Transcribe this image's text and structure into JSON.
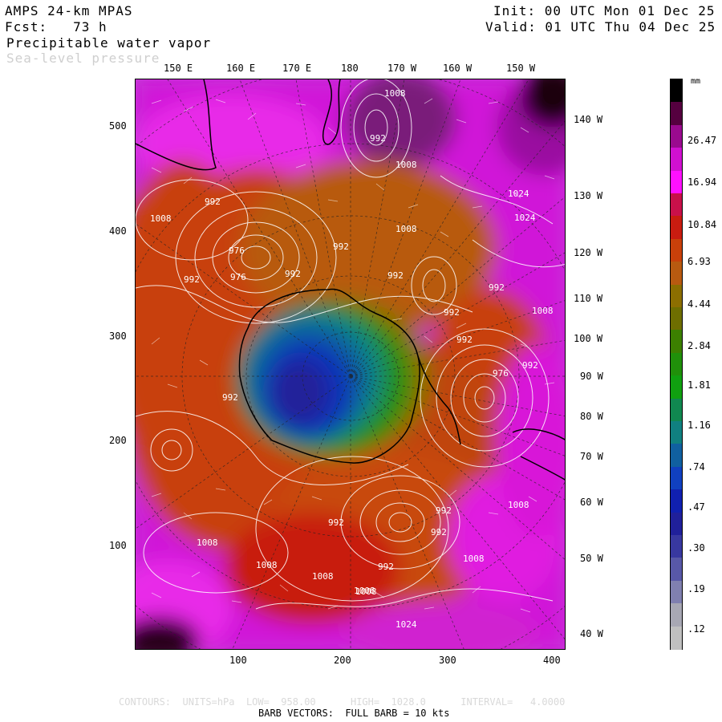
{
  "header": {
    "model": "AMPS 24-km MPAS",
    "fcst": "Fcst:   73 h",
    "field": "Precipitable water vapor",
    "overlay": "Sea-level pressure",
    "init": "Init: 00 UTC Mon 01 Dec 25",
    "valid": "Valid: 01 UTC Thu 04 Dec 25"
  },
  "top_lon_labels": [
    "150 E",
    "160 E",
    "170 E",
    "180",
    "170 W",
    "160 W",
    "150 W"
  ],
  "right_lon_labels": [
    "140 W",
    "130 W",
    "120 W",
    "110 W",
    "100 W",
    "90 W",
    "80 W",
    "70 W",
    "60 W",
    "50 W",
    "40 W"
  ],
  "y_ticks": [
    "500",
    "400",
    "300",
    "200",
    "100"
  ],
  "x_ticks": [
    "100",
    "200",
    "300",
    "400"
  ],
  "colorbar": {
    "unit": "mm",
    "labels": [
      "26.47",
      "16.94",
      "10.84",
      "6.93",
      "4.44",
      "2.84",
      "1.81",
      "1.16",
      ".74",
      ".47",
      ".30",
      ".19",
      ".12"
    ],
    "colors": [
      "#000000",
      "#55003f",
      "#9a0a8f",
      "#d010d0",
      "#ff10ff",
      "#c8104a",
      "#c81c10",
      "#c8400a",
      "#b85a10",
      "#8c6e00",
      "#6e6e00",
      "#3c8000",
      "#20900a",
      "#10a010",
      "#108850",
      "#108080",
      "#1060a0",
      "#1040c0",
      "#1020b0",
      "#20209a",
      "#3838a0",
      "#5858a8",
      "#8080b0",
      "#a8a8b4",
      "#c0c0c0"
    ]
  },
  "pressure_labels": [
    "1008",
    "992",
    "1008",
    "1008",
    "992",
    "976",
    "992",
    "976",
    "992",
    "992",
    "1008",
    "992",
    "1024",
    "1024",
    "992",
    "992",
    "1008",
    "992",
    "992",
    "976",
    "992",
    "992",
    "1008",
    "992",
    "992",
    "1008",
    "1008",
    "1008",
    "1008",
    "1008",
    "992",
    "1008",
    "1024"
  ],
  "footer": {
    "contours": "CONTOURS:  UNITS=hPa  LOW=  958.00      HIGH=  1028.0      INTERVAL=   4.0000",
    "barbs": "BARB VECTORS:  FULL BARB = 10 kts"
  }
}
